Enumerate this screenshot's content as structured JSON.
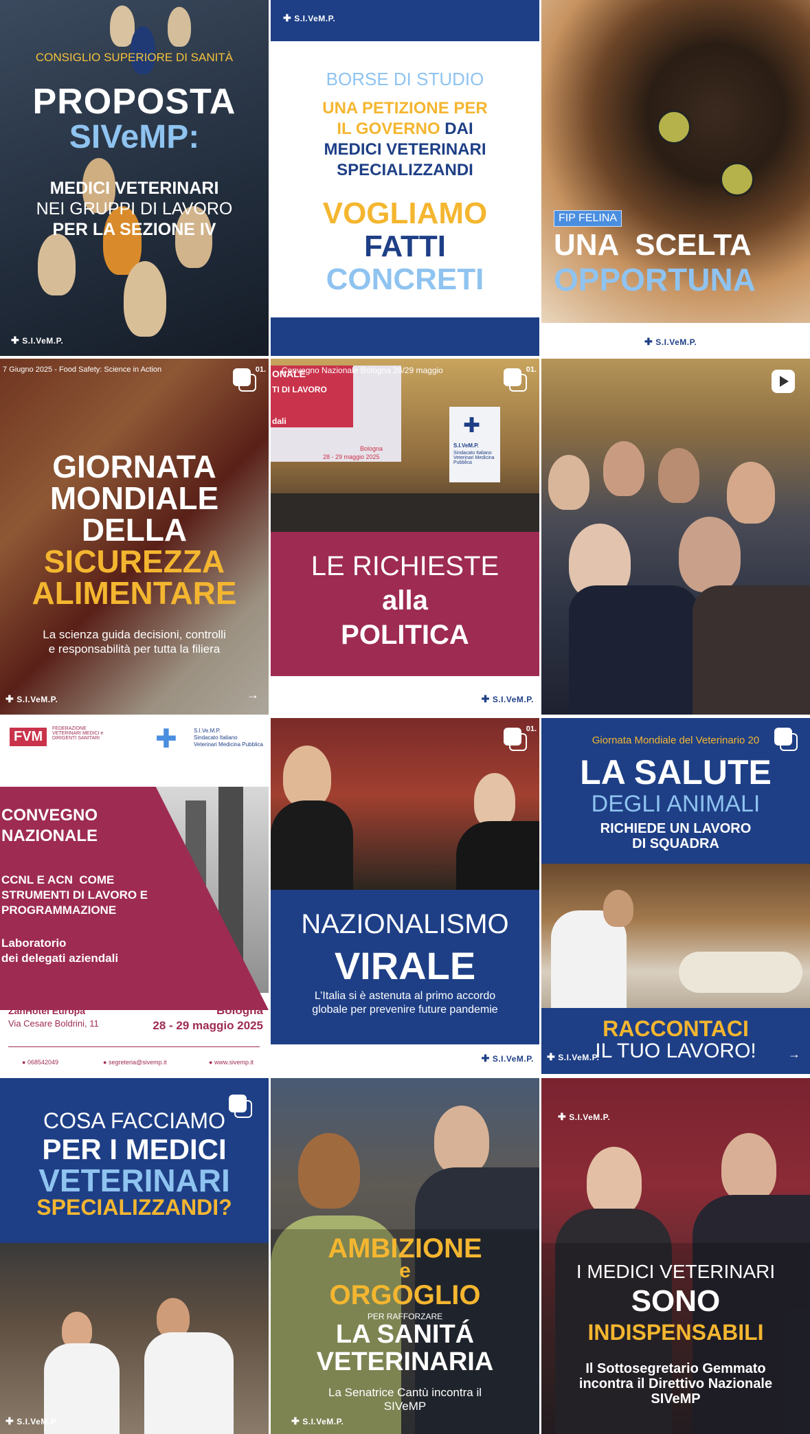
{
  "posts": {
    "p1": {
      "kicker": "CONSIGLIO SUPERIORE DI SANITÀ",
      "t1": "PROPOSTA",
      "t2": "SIVeMP:",
      "t3": "MEDICI VETERINARI",
      "t4": "NEI GRUPPI DI LAVORO",
      "t5": "PER LA SEZIONE IV",
      "logo": "S.I.VeM.P."
    },
    "p2": {
      "logo": "S.I.VeM.P.",
      "kicker": "BORSE DI STUDIO",
      "t1a": "UNA PETIZIONE PER",
      "t1b": "IL GOVERNO",
      "t1c": "DAI",
      "t2": "MEDICI VETERINARI",
      "t3": "SPECIALIZZANDI",
      "t4": "VOGLIAMO",
      "t5": "FATTI",
      "t6": "CONCRETI"
    },
    "p3": {
      "badge": "FIP FELINA",
      "t1": "UNA  SCELTA",
      "t2": "OPPORTUNA",
      "logo": "S.I.VeM.P."
    },
    "p4": {
      "kicker": "7 Giugno 2025 - Food Safety: Science in Action",
      "page": "01.",
      "t1": "GIORNATA",
      "t2": "MONDIALE",
      "t3": "DELLA",
      "t4": "SICUREZZA",
      "t5": "ALIMENTARE",
      "t6": "La scienza guida decisioni, controlli",
      "t7": "e responsabilità per tutta la filiera",
      "logo": "S.I.VeM.P."
    },
    "p5": {
      "kicker": "Convegno Nazionale Bologna 28/29 maggio",
      "page": "01.",
      "banner1": "ONALE",
      "banner2": "TI DI LAVORO",
      "banner3": "dali",
      "banner4": "Bologna",
      "banner5": "28 - 29 maggio 2025",
      "rollup": "S.I.VeM.P.",
      "rollup2": "Sindacato Italiano Veterinari Medicina Pubblica",
      "t1": "LE RICHIESTE",
      "t2": "alla",
      "t3": "POLITICA",
      "logo": "S.I.VeM.P."
    },
    "p6": {},
    "p7": {
      "fvm": "FVM",
      "fvm_sub": "FEDERAZIONE VETERINARI MEDICI e DIRIGENTI SANITARI",
      "siv": "S.I.Ve.M.P.",
      "siv_sub1": "Sindacato Italiano",
      "siv_sub2": "Veterinari Medicina Pubblica",
      "t1": "CONVEGNO",
      "t2": "NAZIONALE",
      "t3": "CCNL E ACN  COME",
      "t4": "STRUMENTI DI LAVORO E",
      "t5": "PROGRAMMAZIONE",
      "t6": "Laboratorio",
      "t7": "dei delegati aziendali",
      "venue": "ZanHotel Europa",
      "address": "Via Cesare Boldrini, 11",
      "city": "Bologna",
      "dates": "28 - 29 maggio 2025",
      "phone": "068542049",
      "email": "segreteria@sivemp.it",
      "web": "www.sivemp.it"
    },
    "p8": {
      "page": "01.",
      "t1": "NAZIONALISMO",
      "t2": "VIRALE",
      "t3": "L’Italia si è astenuta al primo accordo",
      "t4": "globale per prevenire future pandemie",
      "logo": "S.I.VeM.P."
    },
    "p9": {
      "kicker": "Giornata Mondiale del Veterinario 20",
      "t1": "LA SALUTE",
      "t2": "DEGLI ANIMALI",
      "t3": "RICHIEDE UN LAVORO",
      "t4": "DI SQUADRA",
      "t5": "RACCONTACI",
      "t6": "IL TUO LAVORO!",
      "logo": "S.I.VeM.P."
    },
    "p10": {
      "t1": "COSA FACCIAMO",
      "t2": "PER I MEDICI",
      "t3": "VETERINARI",
      "t4": "SPECIALIZZANDI?",
      "logo": "S.I.VeM.P."
    },
    "p11": {
      "t1": "AMBIZIONE",
      "t2": "e",
      "t3": "ORGOGLIO",
      "t4": "PER RAFFORZARE",
      "t5": "LA SANITÁ",
      "t6": "VETERINARIA",
      "t7": "La Senatrice Cantù incontra il",
      "t8": "SIVeMP",
      "logo": "S.I.VeM.P."
    },
    "p12": {
      "logo": "S.I.VeM.P.",
      "t1": "I MEDICI VETERINARI",
      "t2": "SONO",
      "t3": "INDISPENSABILI",
      "t4": "Il Sottosegretario Gemmato",
      "t5": "incontra il Direttivo Nazionale",
      "t6": "SIVeMP"
    }
  },
  "colors": {
    "navy": "#1e3f86",
    "gold": "#f4b630",
    "sky": "#8fc3f0",
    "wine": "#9e2b52"
  },
  "icons": [
    "multi-image-icon",
    "reel-icon",
    "arrow-right-icon",
    "cross-logo-icon"
  ]
}
